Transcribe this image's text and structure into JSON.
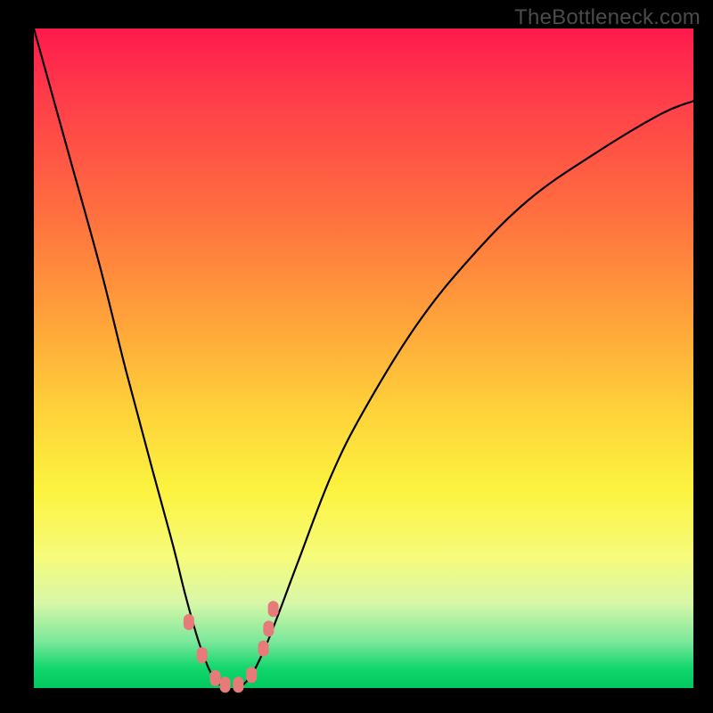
{
  "watermark": "TheBottleneck.com",
  "colors": {
    "frame": "#000000",
    "gradient_top": "#ff1a4d",
    "gradient_mid": "#ffd23a",
    "gradient_bottom": "#00c95f",
    "curve": "#000000",
    "markers": "#e77b79"
  },
  "chart_data": {
    "type": "line",
    "title": "",
    "xlabel": "",
    "ylabel": "",
    "xlim": [
      0,
      100
    ],
    "ylim": [
      0,
      100
    ],
    "grid": false,
    "note": "V-shaped bottleneck curve; y ≈ 100 at edges, ≈ 0 near x ≈ 27–33. Values estimated from pixels.",
    "series": [
      {
        "name": "bottleneck-curve",
        "x": [
          0,
          5,
          10,
          14,
          18,
          21,
          23,
          25,
          27,
          29,
          31,
          33,
          35,
          37,
          40,
          45,
          50,
          58,
          66,
          75,
          85,
          95,
          100
        ],
        "y": [
          100,
          82,
          64,
          48,
          33,
          22,
          14,
          7,
          2,
          0,
          0,
          2,
          6,
          11,
          19,
          32,
          42,
          55,
          65,
          74,
          81,
          87,
          89
        ]
      }
    ],
    "markers": {
      "name": "highlight-points",
      "x": [
        23.5,
        25.5,
        27.5,
        29.0,
        31.0,
        33.0,
        34.8,
        35.6,
        36.3
      ],
      "y": [
        10,
        5,
        1.5,
        0.5,
        0.5,
        2,
        6,
        9,
        12
      ]
    }
  }
}
